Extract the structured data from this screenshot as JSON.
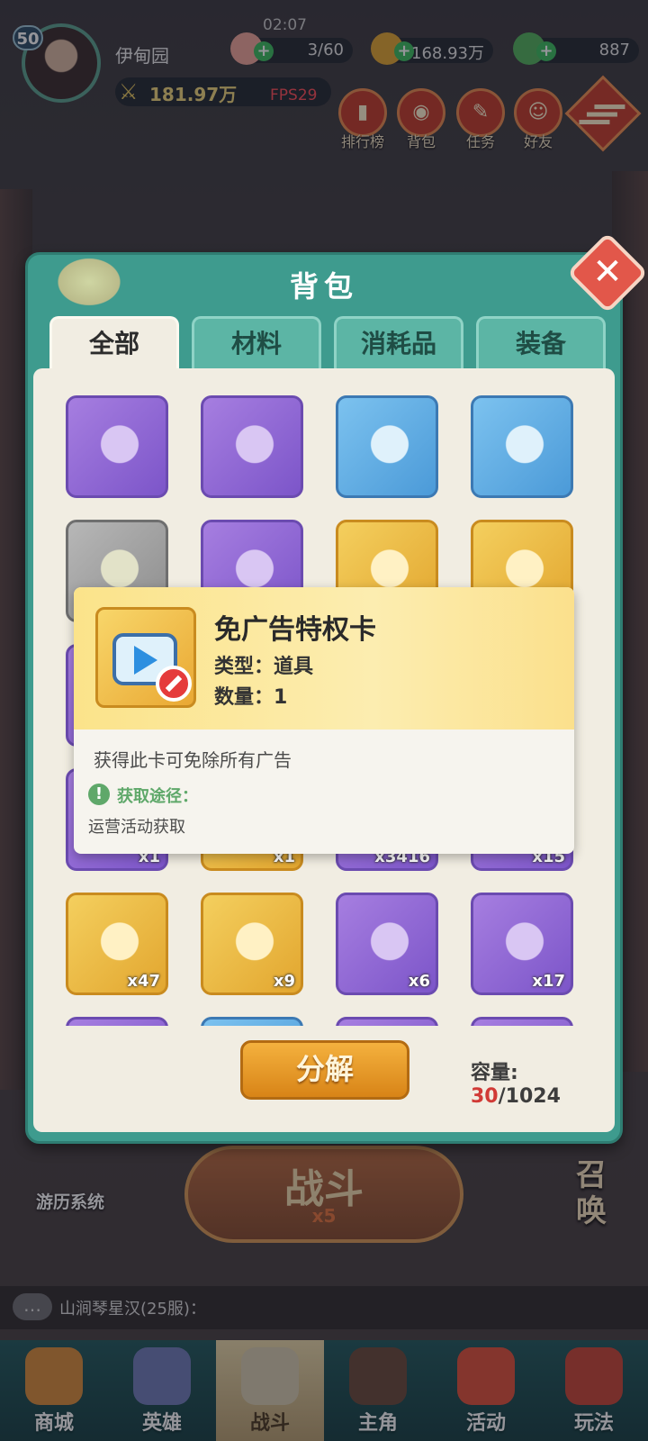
{
  "hud": {
    "level": "50",
    "player_name": "伊甸园",
    "combat_power": "181.97万",
    "fps": "FPS29",
    "time": "02:07",
    "stamina": "3/60",
    "gold": "168.93万",
    "gems": "887",
    "menu": [
      {
        "label": "排行榜",
        "icon": "ranking-icon"
      },
      {
        "label": "背包",
        "icon": "bag-icon"
      },
      {
        "label": "任务",
        "icon": "quest-icon"
      },
      {
        "label": "好友",
        "icon": "friends-icon"
      }
    ]
  },
  "bag": {
    "title": "背包",
    "tabs": [
      "全部",
      "材料",
      "消耗品",
      "装备"
    ],
    "active_tab": "全部",
    "items": [
      {
        "icon": "sword-icon",
        "rarity": "purple",
        "qty": ""
      },
      {
        "icon": "armor-icon",
        "rarity": "purple",
        "qty": ""
      },
      {
        "icon": "necklace-icon",
        "rarity": "blue",
        "qty": ""
      },
      {
        "icon": "boots-icon",
        "rarity": "blue",
        "qty": ""
      },
      {
        "icon": "shoes-icon",
        "rarity": "gray",
        "qty": ""
      },
      {
        "icon": "crystal-icon",
        "rarity": "purple",
        "qty": ""
      },
      {
        "icon": "crystal-cluster-icon",
        "rarity": "gold",
        "qty": ""
      },
      {
        "icon": "red-crystal-icon",
        "rarity": "gold",
        "qty": ""
      },
      {
        "icon": "item-icon",
        "rarity": "purple",
        "qty": ""
      },
      {
        "icon": "item-icon",
        "rarity": "gold",
        "qty": ""
      },
      {
        "icon": "item-icon",
        "rarity": "purple",
        "qty": ""
      },
      {
        "icon": "item-icon",
        "rarity": "gold",
        "qty": ""
      },
      {
        "icon": "item-icon",
        "rarity": "purple",
        "qty": "x1"
      },
      {
        "icon": "item-icon",
        "rarity": "gold",
        "qty": "x1"
      },
      {
        "icon": "item-icon",
        "rarity": "purple",
        "qty": "x3416"
      },
      {
        "icon": "item-icon",
        "rarity": "purple",
        "qty": "x15"
      },
      {
        "icon": "lotus-icon",
        "rarity": "gold",
        "qty": "x47"
      },
      {
        "icon": "water-lotus-icon",
        "rarity": "gold",
        "qty": "x9"
      },
      {
        "icon": "refresh-board-icon",
        "rarity": "purple",
        "qty": "x6"
      },
      {
        "icon": "recycle-plus-icon",
        "rarity": "purple",
        "qty": "x17"
      }
    ],
    "decompose_label": "分解",
    "capacity_label": "容量:",
    "capacity_used": "30",
    "capacity_total": "/1024"
  },
  "tooltip": {
    "name": "免广告特权卡",
    "type": "类型：道具",
    "count": "数量：1",
    "description": "获得此卡可免除所有广告",
    "source_label": "获取途径：",
    "source_value": "运营活动获取"
  },
  "game": {
    "battle_label": "战斗",
    "battle_cost": "x5",
    "travel_label": "游历系统",
    "summon_label": "召唤",
    "chat_message": "山涧琴星汉(25服)："
  },
  "nav": [
    {
      "label": "商城",
      "color": "#d98c3a"
    },
    {
      "label": "英雄",
      "color": "#6f7db8"
    },
    {
      "label": "战斗",
      "color": "#d8ccb0"
    },
    {
      "label": "主角",
      "color": "#6b4a3a"
    },
    {
      "label": "活动",
      "color": "#e0503a"
    },
    {
      "label": "玩法",
      "color": "#c84636"
    }
  ],
  "colors": {
    "accent_teal": "#3e9b8e",
    "capacity_red": "#d13a36",
    "fps_red": "#ff4d57"
  }
}
